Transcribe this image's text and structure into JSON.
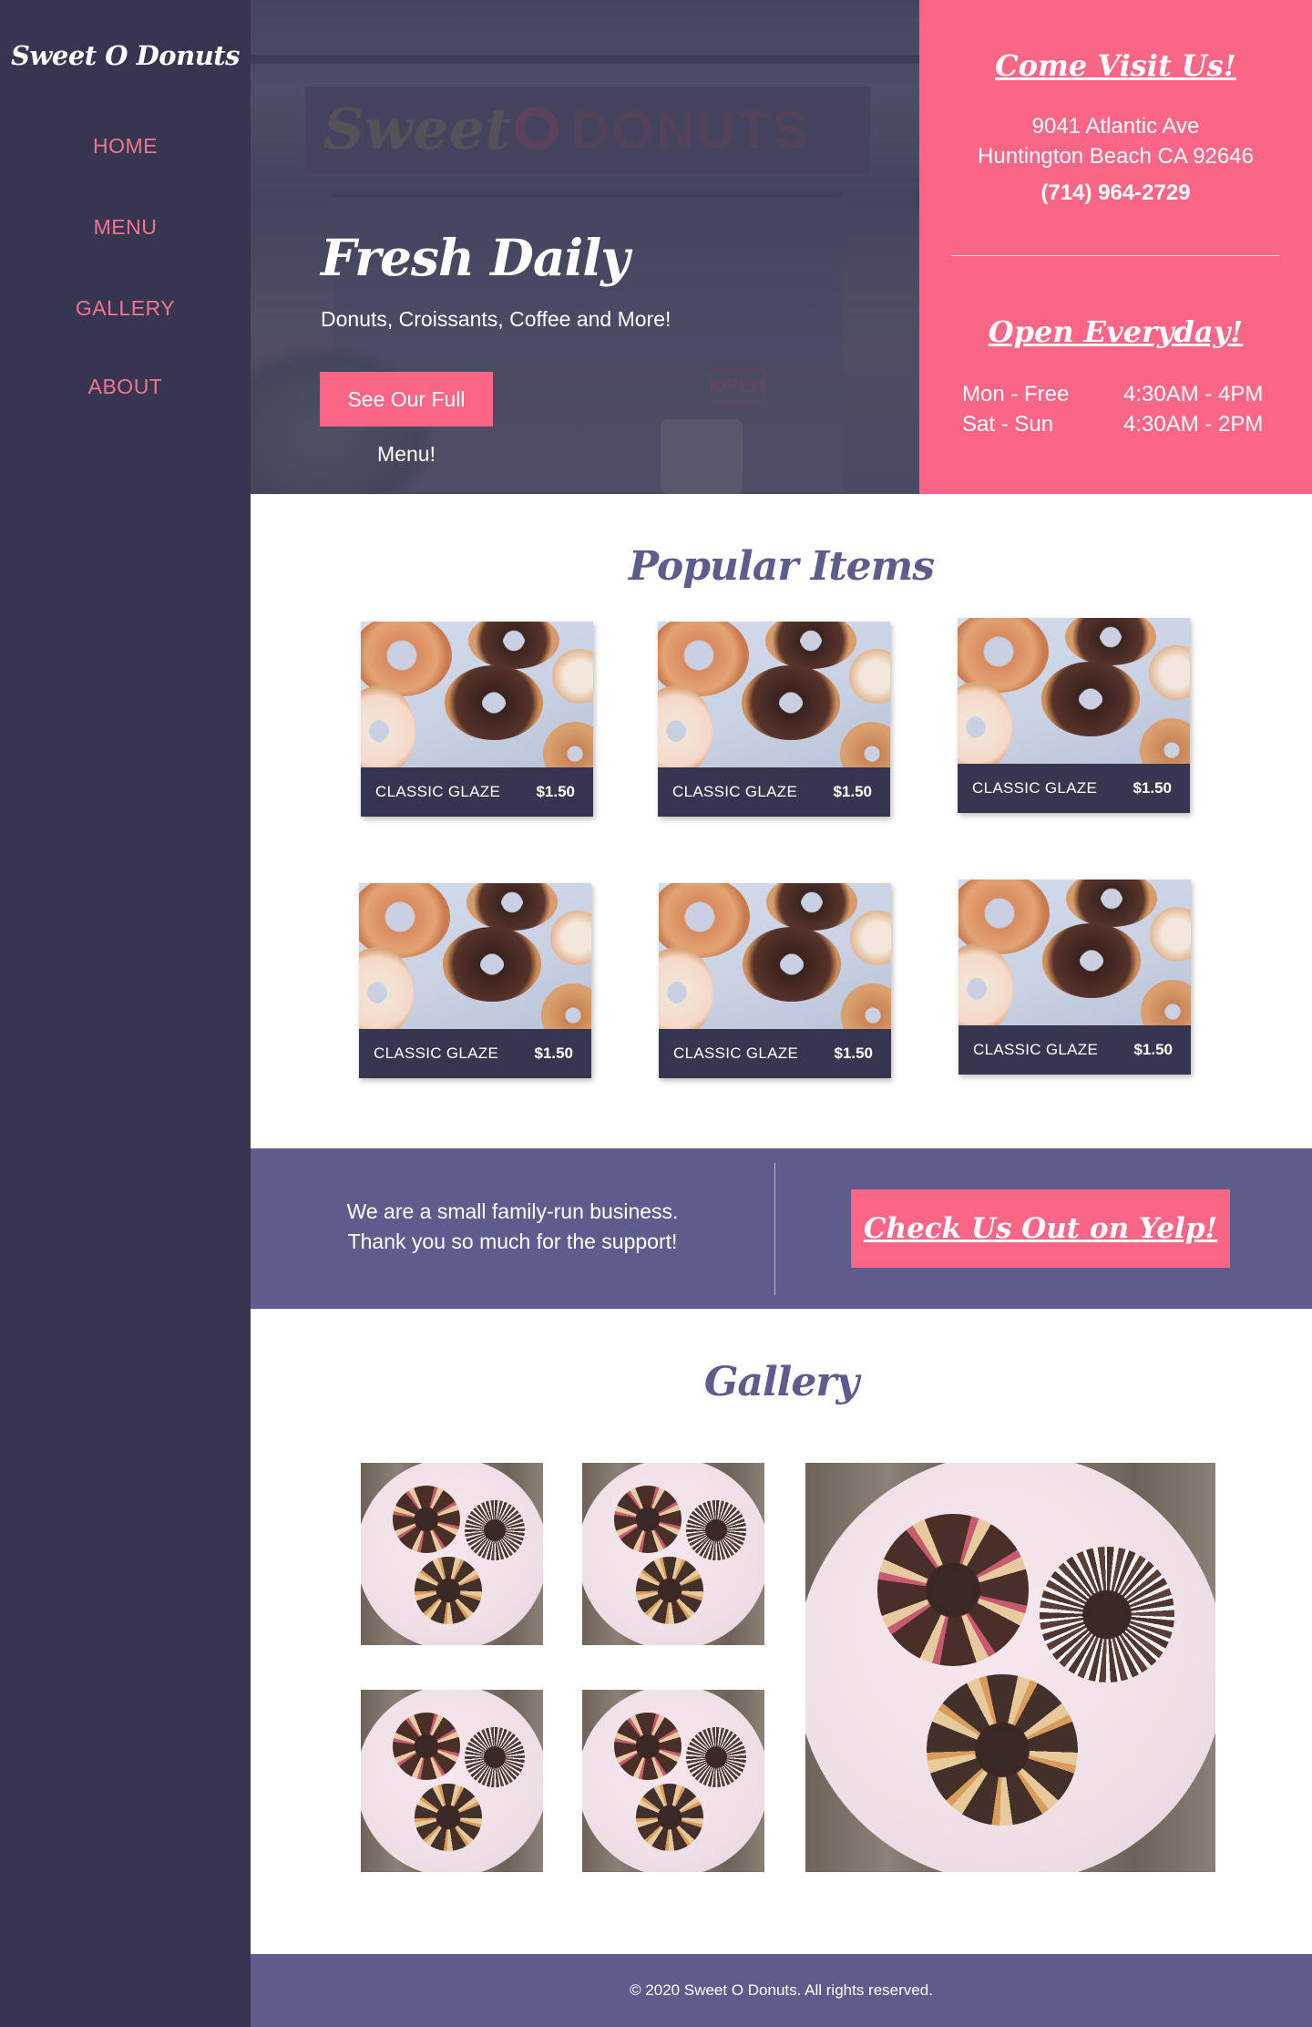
{
  "brand": "Sweet O Donuts",
  "nav": [
    {
      "label": "HOME"
    },
    {
      "label": "MENU"
    },
    {
      "label": "GALLERY"
    },
    {
      "label": "ABOUT"
    }
  ],
  "hero": {
    "title": "Fresh Daily",
    "subtitle": "Donuts, Croissants, Coffee and More!",
    "cta": "See Our Full Menu!",
    "store_sign_script": "Sweet",
    "store_sign_block": "DONUTS",
    "open_sign": "OPEN"
  },
  "info": {
    "visit_heading": "Come Visit Us!",
    "address_line1": "9041 Atlantic Ave",
    "address_line2": "Huntington Beach CA 92646",
    "phone": "(714) 964-2729",
    "hours_heading": "Open Everyday!",
    "hours": [
      {
        "day": "Mon - Free",
        "time": "4:30AM - 4PM"
      },
      {
        "day": "Sat - Sun",
        "time": "4:30AM - 2PM"
      }
    ]
  },
  "popular": {
    "title": "Popular Items",
    "items": [
      {
        "name": "CLASSIC GLAZE",
        "price": "$1.50"
      },
      {
        "name": "CLASSIC GLAZE",
        "price": "$1.50"
      },
      {
        "name": "CLASSIC GLAZE",
        "price": "$1.50"
      },
      {
        "name": "CLASSIC GLAZE",
        "price": "$1.50"
      },
      {
        "name": "CLASSIC GLAZE",
        "price": "$1.50"
      },
      {
        "name": "CLASSIC GLAZE",
        "price": "$1.50"
      }
    ]
  },
  "banner": {
    "line1": "We are a small family-run business.",
    "line2": "Thank you so much for the support!",
    "yelp_button": "Check Us Out on Yelp!"
  },
  "gallery": {
    "title": "Gallery"
  },
  "footer": {
    "copyright": "© 2020 Sweet O Donuts. All rights reserved."
  },
  "colors": {
    "sidebar": "#373650",
    "accent_pink": "#fb6687",
    "purple": "#5e5c8d",
    "nav_text": "#f4738f"
  }
}
